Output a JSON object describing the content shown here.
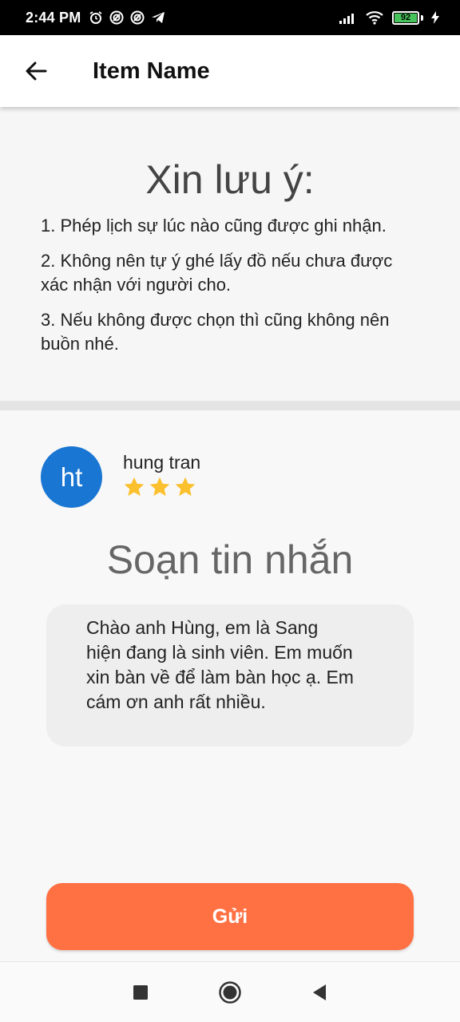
{
  "status_bar": {
    "time": "2:44 PM",
    "battery_level": "92",
    "icons": [
      "alarm-icon",
      "sync-icon",
      "sync-icon",
      "telegram-icon",
      "signal-icon",
      "wifi-icon",
      "battery-icon",
      "charging-icon"
    ]
  },
  "app_bar": {
    "title": "Item Name",
    "back_icon": "arrow-left-icon"
  },
  "notice": {
    "title": "Xin lưu ý:",
    "items": [
      "1. Phép lịch sự lúc nào cũng được ghi nhận.",
      "2. Không nên tự ý ghé lấy đồ nếu chưa được xác nhận với người cho.",
      "3. Nếu không được chọn thì cũng không nên buồn nhé."
    ]
  },
  "user": {
    "initials": "ht",
    "name": "hung tran",
    "rating": 3,
    "avatar_color": "#1976d2",
    "star_color": "#fbc02d"
  },
  "compose": {
    "title": "Soạn tin nhắn",
    "message": "Chào anh Hùng, em là Sang hiện đang là sinh viên. Em muốn xin bàn về để làm bàn học ạ. Em cám ơn anh rất nhiều."
  },
  "send_button": {
    "label": "Gửi",
    "color": "#ff7043"
  },
  "nav_bar": {
    "icons": [
      "recents-square-icon",
      "home-circle-icon",
      "back-triangle-icon"
    ]
  }
}
